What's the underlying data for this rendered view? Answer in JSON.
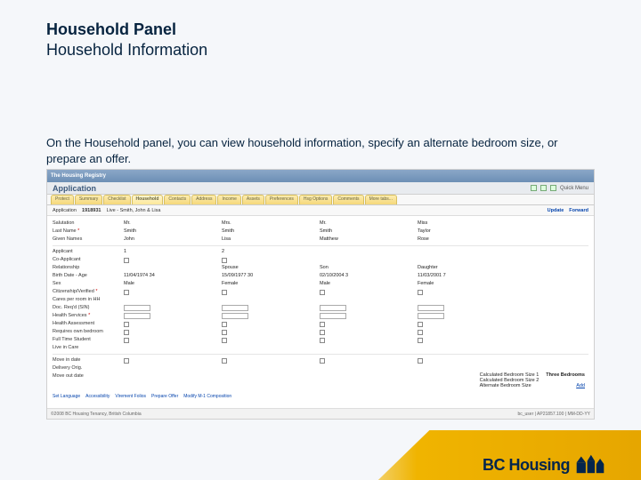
{
  "slide": {
    "title_line1": "Household Panel",
    "title_line2": "Household Information",
    "description": "On the Household panel, you can view household information, specify an alternate bedroom size, or prepare an offer."
  },
  "app": {
    "window_brand": "The Housing Registry",
    "title": "Application",
    "quick_menu_label": "Quick Menu",
    "tabs": [
      "Protect",
      "Summary",
      "Checklist",
      "Household",
      "Contacts",
      "Address",
      "Income",
      "Assets",
      "Preferences",
      "Hsg Options",
      "Comments",
      "More tabs..."
    ],
    "active_tab": "Household",
    "toolbar": {
      "label": "Application",
      "number": "1918931",
      "status": "Live - Smith, John & Lisa",
      "actions": [
        "Update",
        "Forward"
      ]
    },
    "rows": {
      "salutation": {
        "label": "Salutation",
        "cols": [
          "Mr.",
          "Mrs.",
          "Mr.",
          "Miss"
        ]
      },
      "last_name": {
        "label": "Last Name",
        "star": true,
        "cols": [
          "Smith",
          "Smith",
          "Smith",
          "Taylor"
        ]
      },
      "given_names": {
        "label": "Given Names",
        "cols": [
          "John",
          "Lisa",
          "Matthew",
          "Rose"
        ]
      },
      "applicant": {
        "label": "Applicant",
        "cols": [
          "1",
          "2",
          "",
          ""
        ]
      },
      "co_applicant": {
        "label": "Co-Applicant",
        "cols": [
          "",
          "",
          "",
          ""
        ]
      },
      "relationship": {
        "label": "Relationship",
        "cols": [
          "",
          "Spouse",
          "Son",
          "Daughter"
        ]
      },
      "birth_age": {
        "label": "Birth Date - Age",
        "cols": [
          "11/04/1974   34",
          "15/09/1977   30",
          "02/10/2004   3",
          "11/03/2001   7"
        ]
      },
      "sex": {
        "label": "Sex",
        "cols": [
          "Male",
          "Female",
          "Male",
          "Female"
        ]
      },
      "citizen": {
        "label": "Citizenship/Verified",
        "star": true,
        "cols_type": "check"
      },
      "cares": {
        "label": "Cares per room in HH",
        "cols": [
          "",
          "",
          "",
          ""
        ]
      },
      "docs": {
        "label": "Doc. Req'd (SIN)",
        "cols_type": "input"
      },
      "health_svc": {
        "label": "Health Services",
        "star": true,
        "cols_type": "input"
      },
      "health_assess": {
        "label": "Health Assessment",
        "cols_type": "check"
      },
      "req_own": {
        "label": "Requires own bedroom",
        "cols_type": "check"
      },
      "ft_student": {
        "label": "Full Time Student",
        "cols_type": "check"
      },
      "live_in": {
        "label": "Live in Care",
        "cols": [
          "",
          "",
          "",
          ""
        ]
      },
      "move_in": {
        "label": "Move in date",
        "cols_type": "check"
      },
      "delivery": {
        "label": "Delivery Orig.",
        "cols": [
          "",
          "",
          "",
          ""
        ]
      },
      "move_out": {
        "label": "Move out date",
        "cols": [
          "",
          "",
          "",
          ""
        ]
      }
    },
    "calc": {
      "line1_label": "Calculated Bedroom Size 1",
      "line1_value": "Three Bedrooms",
      "line2_label": "Calculated Bedroom Size 2",
      "line3_label": "Alternate Bedroom Size",
      "line3_link": "Add"
    },
    "bottom_links": [
      "Set Language",
      "Accessibility",
      "Virement Folios",
      "Prepare Offer",
      "Modify M-1 Composition"
    ],
    "footer_left": "©2008 BC Housing Tenancy, British Columbia",
    "footer_right": "bc_user | AP21857.100 | MM-DD-YY"
  },
  "brand": {
    "text": "BC Housing"
  }
}
